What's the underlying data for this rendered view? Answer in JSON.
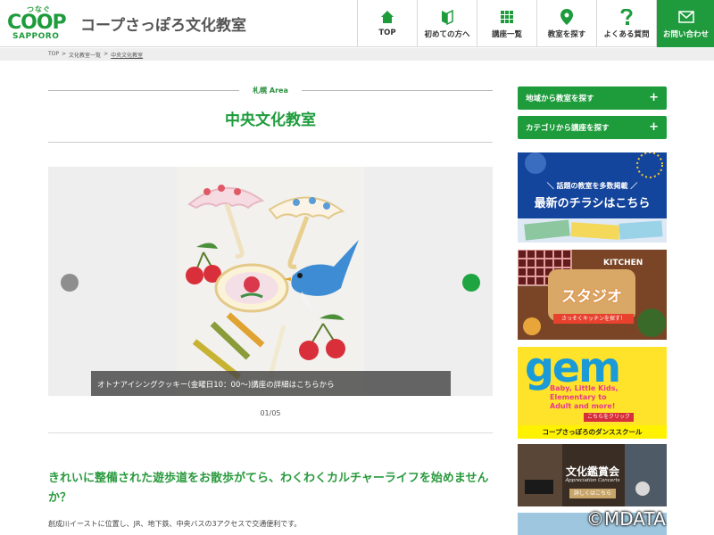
{
  "header": {
    "logo": {
      "tagline": "つなぐ",
      "brand": "COOP",
      "sub": "SAPPORO"
    },
    "site_title": "コープさっぽろ文化教室",
    "nav": [
      {
        "label": "TOP",
        "icon": "home-icon"
      },
      {
        "label": "初めての方へ",
        "icon": "beginner-mark-icon"
      },
      {
        "label": "講座一覧",
        "icon": "grid-icon"
      },
      {
        "label": "教室を探す",
        "icon": "map-pin-icon"
      },
      {
        "label": "よくある質問",
        "icon": "question-icon"
      },
      {
        "label": "お問い合わせ",
        "icon": "mail-icon"
      }
    ],
    "accent_color": "#1e9c3c"
  },
  "breadcrumb": {
    "items": [
      "TOP",
      "文化教室一覧",
      "中央文化教室"
    ],
    "separator": ">"
  },
  "main": {
    "area_label": "札幌 Area",
    "title": "中央文化教室",
    "slider": {
      "caption": "オトナアイシングクッキー(金曜日10：00〜)講座の詳細はこちらから",
      "counter": "01/05"
    },
    "lead": "きれいに整備された遊歩道をお散歩がてら、わくわくカルチャーライフを始めませんか？",
    "body": "創成川イーストに位置し、JR、地下鉄、中央バスの3アクセスで交通便利です。"
  },
  "sidebar": {
    "buttons": [
      {
        "label": "地域から教室を探す"
      },
      {
        "label": "カテゴリから講座を探す"
      }
    ],
    "banners": {
      "flyer": {
        "tag": "＼ 話題の教室を多数掲載 ／",
        "headline": "最新のチラシはこちら"
      },
      "kitchen": {
        "sign": "KITCHEN",
        "title": "スタジオ",
        "sub": "さっそくキッチンを探す！"
      },
      "gem": {
        "logo": "gem",
        "tagline": "Baby, Little Kids, Elementary to Adult and more!",
        "button": "こちらをクリック",
        "footer": "コープさっぽろのダンススクール"
      },
      "art": {
        "title": "文化鑑賞会",
        "sub": "Appreciation Concerts",
        "button": "詳しくはこちら"
      }
    }
  },
  "watermark": "©MDATA"
}
